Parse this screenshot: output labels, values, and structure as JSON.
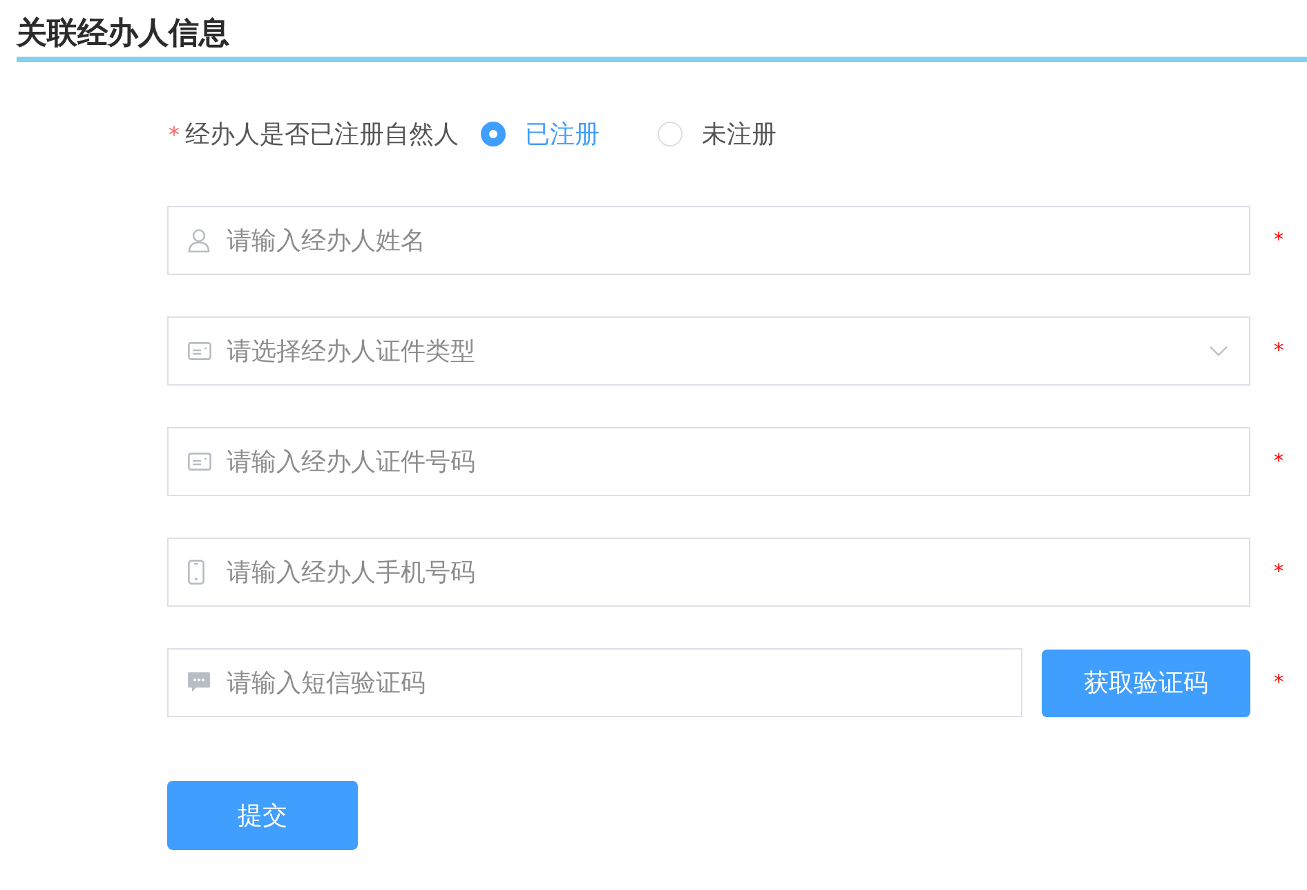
{
  "title": "关联经办人信息",
  "registration": {
    "required_mark": "*",
    "label": "经办人是否已注册自然人",
    "options": [
      {
        "label": "已注册",
        "selected": true
      },
      {
        "label": "未注册",
        "selected": false
      }
    ]
  },
  "fields": [
    {
      "kind": "input",
      "placeholder": "请输入经办人姓名",
      "required_mark": "*"
    },
    {
      "kind": "select",
      "placeholder": "请选择经办人证件类型",
      "required_mark": "*"
    },
    {
      "kind": "input",
      "placeholder": "请输入经办人证件号码",
      "required_mark": "*"
    },
    {
      "kind": "input",
      "placeholder": "请输入经办人手机号码",
      "required_mark": "*"
    },
    {
      "kind": "code",
      "placeholder": "请输入短信验证码",
      "required_mark": "*",
      "button": "获取验证码"
    }
  ],
  "submit": "提交"
}
